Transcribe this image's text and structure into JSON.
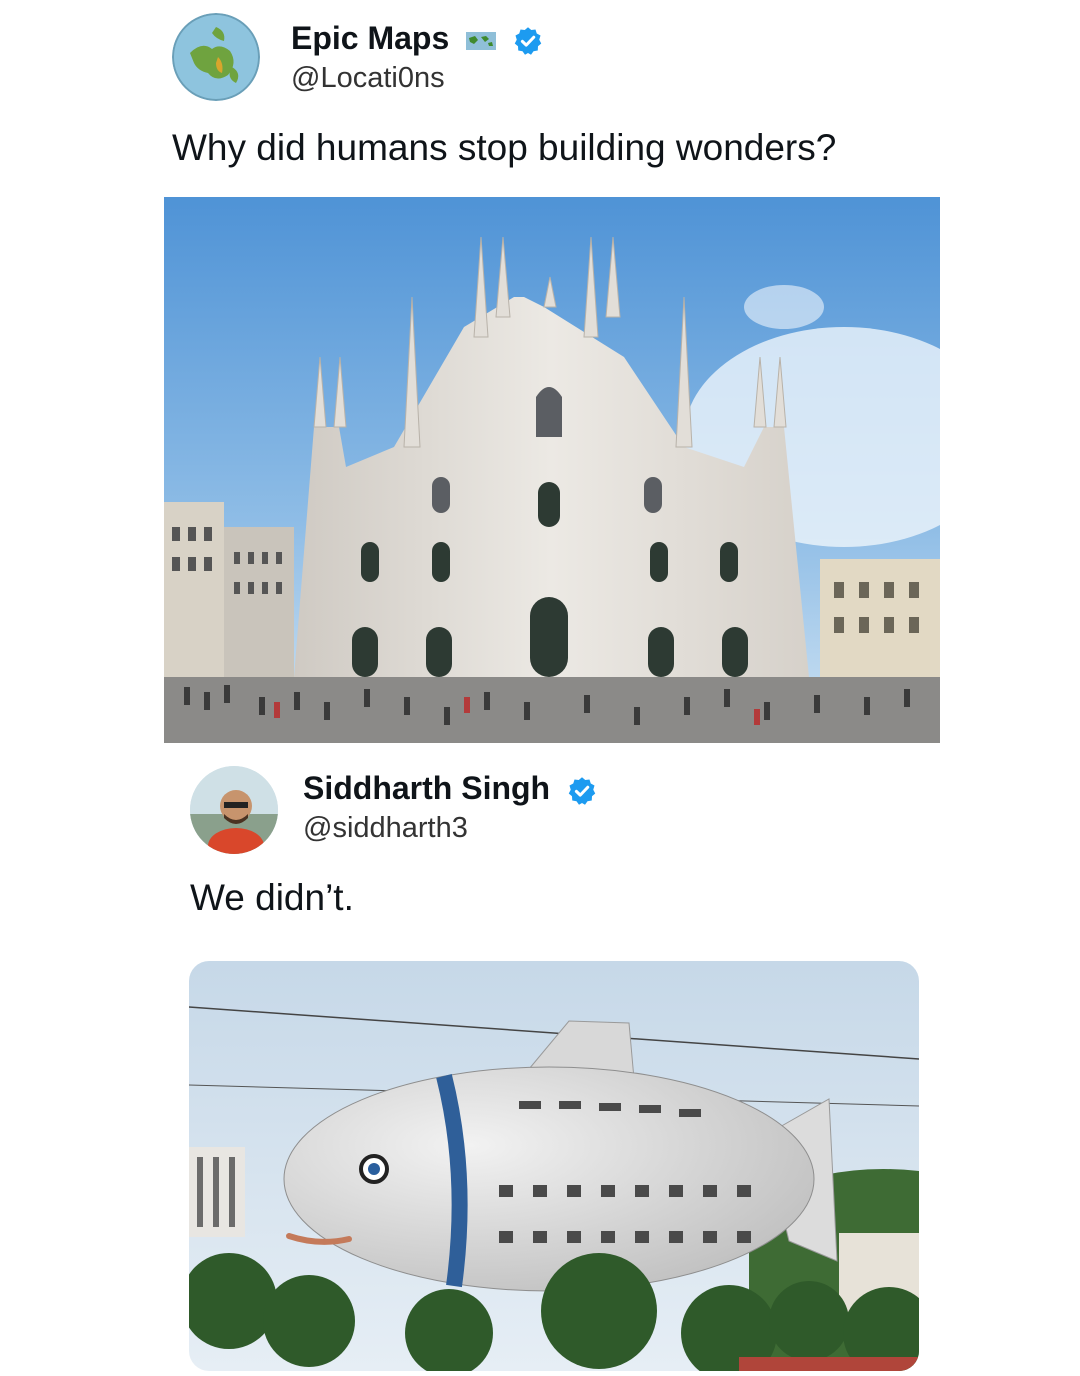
{
  "tweet1": {
    "display_name": "Epic Maps",
    "handle": "@Locati0ns",
    "text": "Why did humans stop building wonders?",
    "verified": true,
    "image": {
      "subject": "gothic-cathedral-photo"
    }
  },
  "tweet2": {
    "display_name": "Siddharth Singh",
    "handle": "@siddharth3",
    "text": "We didn’t.",
    "verified": true,
    "image": {
      "subject": "fish-shaped-building-photo"
    }
  },
  "colors": {
    "verified_blue": "#1d9bf0",
    "sky_top": "#4f93d6",
    "sky_bottom": "#cfe3f3",
    "marble": "#e6e3de"
  }
}
